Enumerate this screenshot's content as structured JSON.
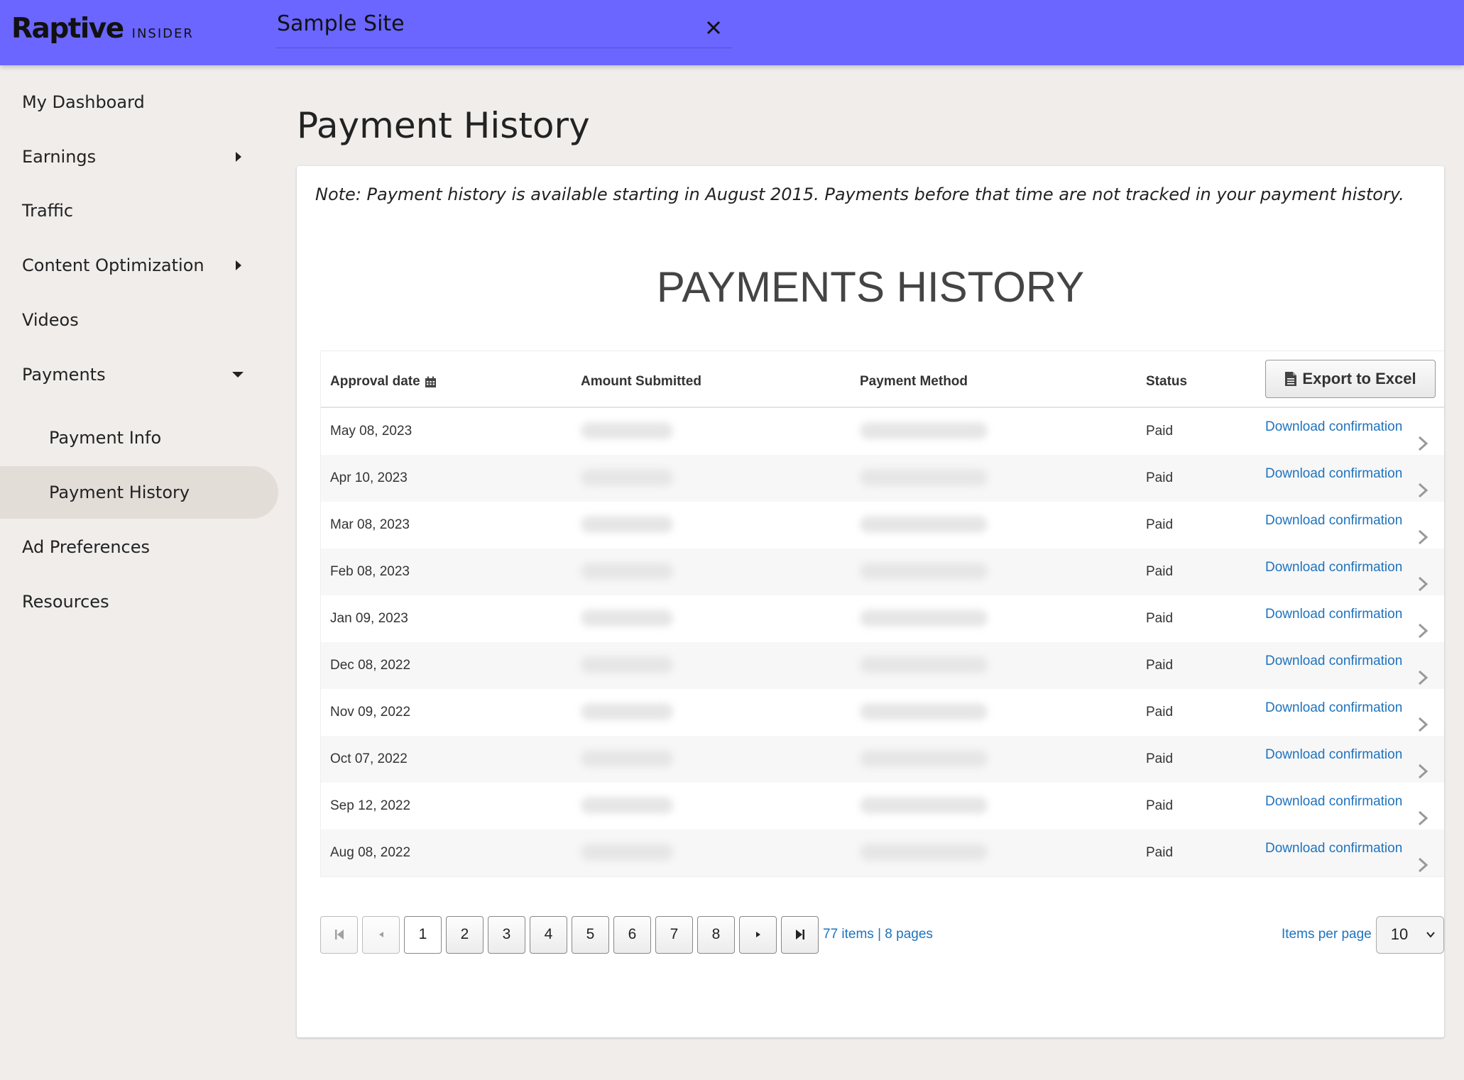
{
  "header": {
    "brand": "Raptive",
    "brand_sub": "INSIDER",
    "site_name": "Sample Site",
    "accent_color": "#6a66ff"
  },
  "sidebar": {
    "items": [
      {
        "label": "My Dashboard"
      },
      {
        "label": "Earnings"
      },
      {
        "label": "Traffic"
      },
      {
        "label": "Content Optimization"
      },
      {
        "label": "Videos"
      },
      {
        "label": "Payments"
      },
      {
        "label": "Payment Info"
      },
      {
        "label": "Payment History"
      },
      {
        "label": "Ad Preferences"
      },
      {
        "label": "Resources"
      }
    ]
  },
  "main": {
    "title": "Payment History",
    "note": "Note: Payment history is available starting in August 2015. Payments before that time are not tracked in your payment history.",
    "heading": "PAYMENTS HISTORY"
  },
  "grid": {
    "columns": [
      "Approval date",
      "Amount Submitted",
      "Payment Method",
      "Status"
    ],
    "export_label": "Export to Excel",
    "download_label": "Download confirmation",
    "rows": [
      {
        "date": "May 08, 2023",
        "status": "Paid"
      },
      {
        "date": "Apr 10, 2023",
        "status": "Paid"
      },
      {
        "date": "Mar 08, 2023",
        "status": "Paid"
      },
      {
        "date": "Feb 08, 2023",
        "status": "Paid"
      },
      {
        "date": "Jan 09, 2023",
        "status": "Paid"
      },
      {
        "date": "Dec 08, 2022",
        "status": "Paid"
      },
      {
        "date": "Nov 09, 2022",
        "status": "Paid"
      },
      {
        "date": "Oct 07, 2022",
        "status": "Paid"
      },
      {
        "date": "Sep 12, 2022",
        "status": "Paid"
      },
      {
        "date": "Aug 08, 2022",
        "status": "Paid"
      }
    ]
  },
  "pager": {
    "pages": [
      "1",
      "2",
      "3",
      "4",
      "5",
      "6",
      "7",
      "8"
    ],
    "current_page": "1",
    "info": "77 items | 8 pages",
    "items_per_page_label": "Items per page",
    "items_per_page": "10"
  },
  "icons": {
    "close": "close-icon",
    "calendar": "calendar-icon",
    "export": "document-icon",
    "row_chevron": "chevron-right-icon"
  }
}
